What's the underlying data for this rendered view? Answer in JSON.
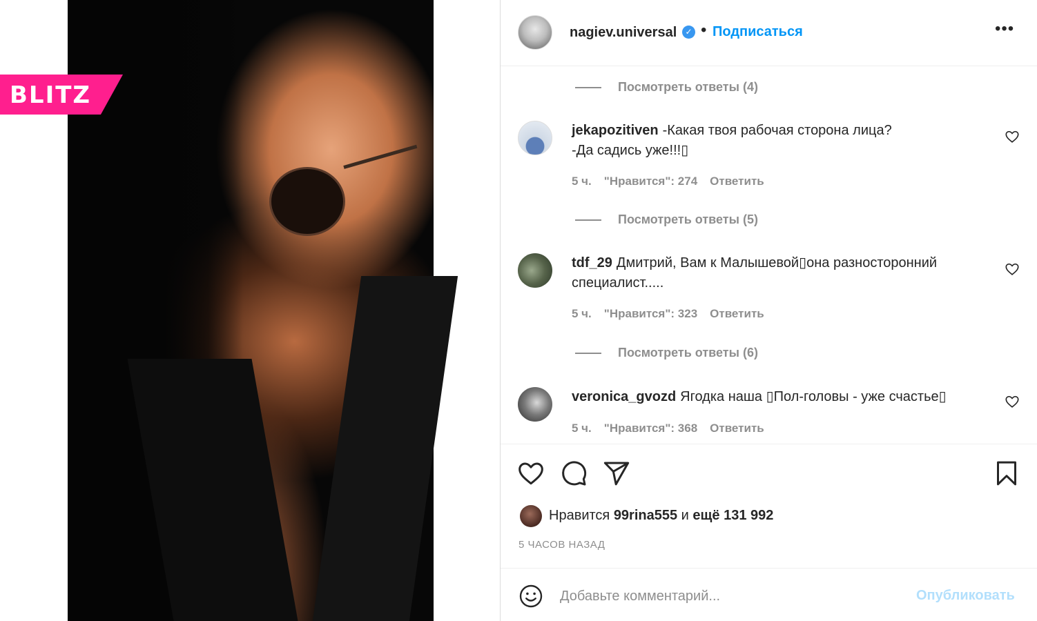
{
  "logo": {
    "text": "BLITZ"
  },
  "post": {
    "author": "nagiev.universal",
    "separator": "•",
    "follow_label": "Подписаться",
    "more_label": "•••"
  },
  "comments": [
    {
      "replies_label": "Посмотреть ответы (4)"
    },
    {
      "user": "jekapozitiven",
      "text_line1": "-Какая твоя рабочая сторона лица?",
      "text_line2": "-Да садись уже!!!▯",
      "time": "5 ч.",
      "likes": "\"Нравится\": 274",
      "reply": "Ответить",
      "replies_label": "Посмотреть ответы (5)"
    },
    {
      "user": "tdf_29",
      "text_line1": "Дмитрий, Вам к Малышевой▯она разносторонний",
      "text_line2": "специалист.....",
      "time": "5 ч.",
      "likes": "\"Нравится\": 323",
      "reply": "Ответить",
      "replies_label": "Посмотреть ответы (6)"
    },
    {
      "user": "veronica_gvozd",
      "text_line1": "Ягодка наша ▯Пол-головы - уже счастье▯",
      "time": "5 ч.",
      "likes": "\"Нравится\": 368",
      "reply": "Ответить"
    }
  ],
  "likes_summary": {
    "prefix": "Нравится ",
    "user": "99rina555",
    "middle": " и ",
    "count": "ещё 131 992"
  },
  "timestamp": "5 ЧАСОВ НАЗАД",
  "comment_box": {
    "placeholder": "Добавьте комментарий...",
    "publish_label": "Опубликовать"
  },
  "colors": {
    "brand_pink": "#ff1f8e",
    "link_blue": "#0095f6",
    "publish_disabled": "#b2dffc",
    "muted": "#8e8e8e"
  },
  "icons": [
    "verified-badge-icon",
    "heart-icon",
    "comment-icon",
    "share-icon",
    "bookmark-icon",
    "emoji-icon",
    "more-icon"
  ]
}
